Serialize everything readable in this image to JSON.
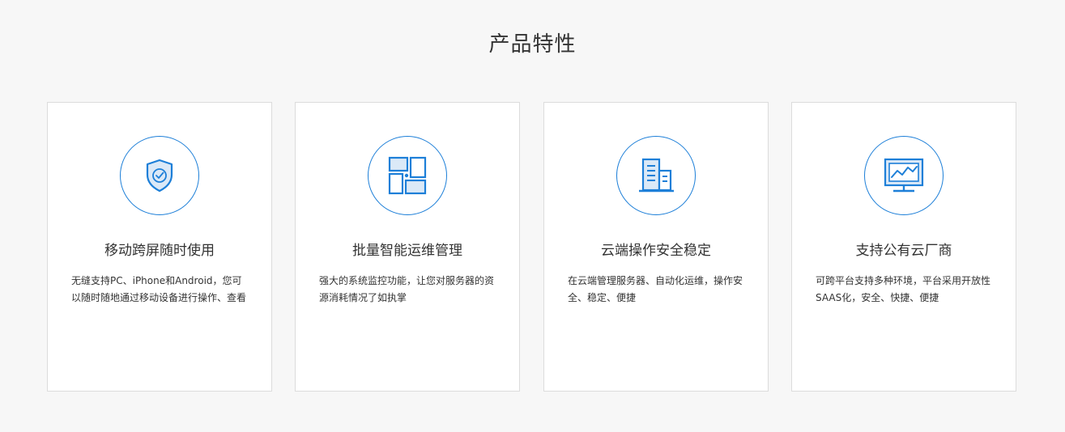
{
  "section": {
    "title": "产品特性"
  },
  "colors": {
    "accent": "#1d7fd8",
    "icon_fill": "#dbe9f7",
    "background": "#f7f7f7",
    "card": "#ffffff",
    "border": "#dcdcdc"
  },
  "features": [
    {
      "icon": "shield-check-icon",
      "title": "移动跨屏随时使用",
      "desc": "无缝支持PC、iPhone和Android，您可以随时随地通过移动设备进行操作、查看"
    },
    {
      "icon": "dashboard-grid-icon",
      "title": "批量智能运维管理",
      "desc": "强大的系统监控功能，让您对服务器的资源消耗情况了如执掌"
    },
    {
      "icon": "buildings-icon",
      "title": "云端操作安全稳定",
      "desc": "在云端管理服务器、自动化运维，操作安全、稳定、便捷"
    },
    {
      "icon": "monitor-chart-icon",
      "title": "支持公有云厂商",
      "desc": "可跨平台支持多种环境，平台采用开放性SAAS化，安全、快捷、便捷"
    }
  ]
}
